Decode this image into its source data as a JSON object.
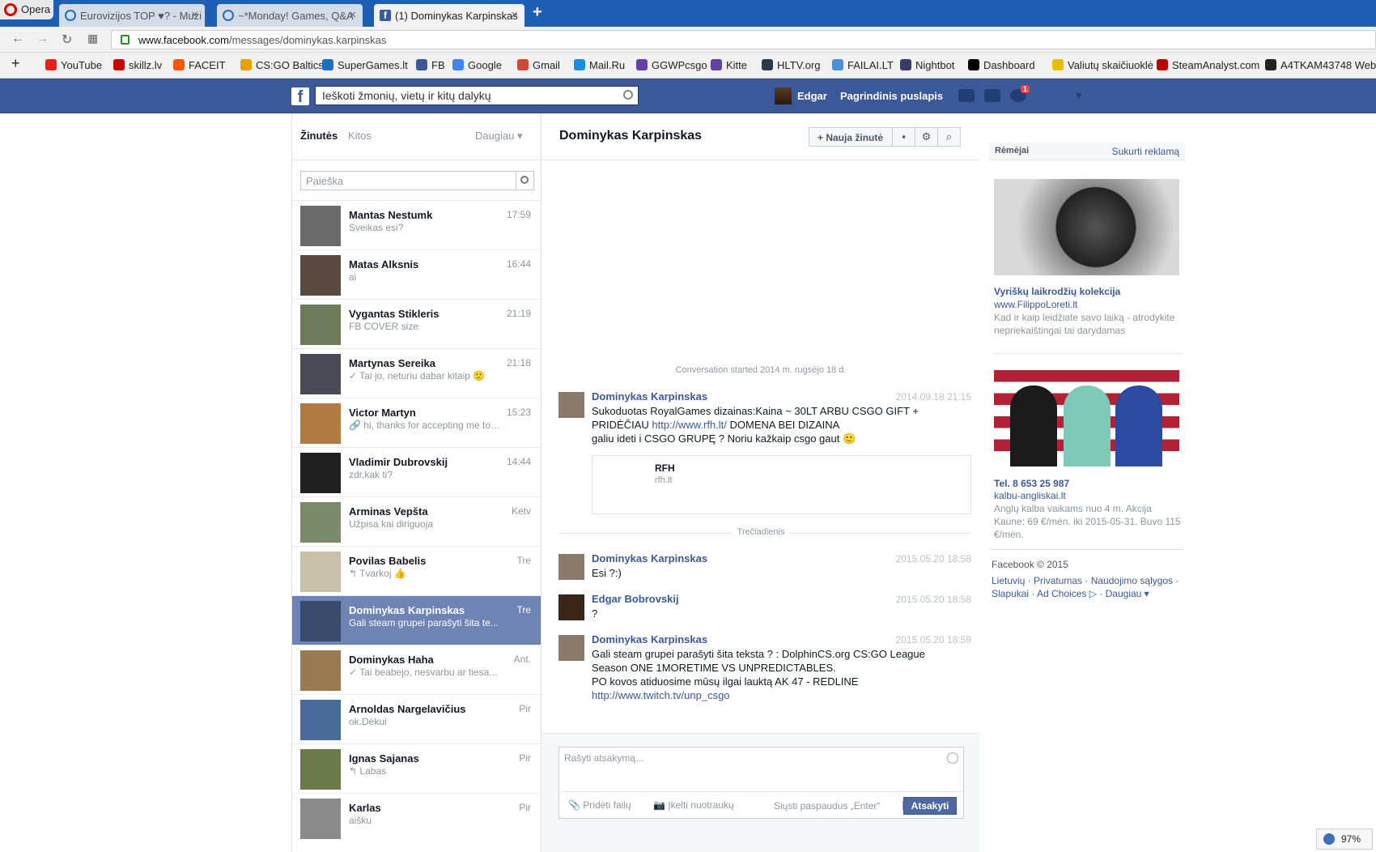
{
  "browser": {
    "opera_label": "Opera",
    "tabs": [
      {
        "label": "Eurovizijos TOP ♥? - Muzi"
      },
      {
        "label": "~*Monday! Games, Q&A"
      },
      {
        "label": "(1) Dominykas Karpinskas"
      }
    ],
    "url_domain": "www.facebook.com",
    "url_path": "/messages/dominykas.karpinskas",
    "bookmarks": [
      {
        "label": "YouTube",
        "color": "#e62117"
      },
      {
        "label": "skillz.lv",
        "color": "#d00000"
      },
      {
        "label": "FACEIT",
        "color": "#ff5500"
      },
      {
        "label": "CS:GO Baltics",
        "color": "#e8a000"
      },
      {
        "label": "SuperGames.lt",
        "color": "#1c6fc4"
      },
      {
        "label": "FB",
        "color": "#3b5998"
      },
      {
        "label": "Google",
        "color": "#4285f4"
      },
      {
        "label": "Gmail",
        "color": "#d44638"
      },
      {
        "label": "Mail.Ru",
        "color": "#168de2"
      },
      {
        "label": "GGWPcsgo",
        "color": "#6441a5"
      },
      {
        "label": "Kitte",
        "color": "#6441a5"
      },
      {
        "label": "HLTV.org",
        "color": "#2b3a4a"
      },
      {
        "label": "FAILAI.LT",
        "color": "#4a90d9"
      },
      {
        "label": "Nightbot",
        "color": "#3b3b6b"
      },
      {
        "label": "Dashboard",
        "color": "#000000"
      },
      {
        "label": "Valiutų skaičiuoklė",
        "color": "#e8c000"
      },
      {
        "label": "SteamAnalyst.com",
        "color": "#c00000"
      },
      {
        "label": "A4TKAM43748 Web",
        "color": "#222222"
      }
    ]
  },
  "fb": {
    "search_placeholder": "Ieškoti žmonių, vietų ir kitų dalykų",
    "user_name": "Edgar",
    "home_label": "Pagrindinis puslapis",
    "notif_count": "1"
  },
  "inbox": {
    "tab_messages": "Žinutės",
    "tab_other": "Kitos",
    "more_label": "Daugiau ▾",
    "search_placeholder": "Paieška",
    "threads": [
      {
        "name": "Mantas Nestumk",
        "snippet": "Sveikas esi?",
        "time": "17:59"
      },
      {
        "name": "Matas Alksnis",
        "snippet": "ai",
        "time": "16:44"
      },
      {
        "name": "Vygantas Stikleris",
        "snippet": "FB COVER size",
        "time": "21:19"
      },
      {
        "name": "Martynas Sereika",
        "snippet": "✓ Tai jo, neturiu dabar kitaip 🙁",
        "time": "21:18"
      },
      {
        "name": "Victor Martyn",
        "snippet": "🔗 hi, thanks for accepting me to t...",
        "time": "15:23"
      },
      {
        "name": "Vladimir Dubrovskij",
        "snippet": "zdr,kak ti?",
        "time": "14:44"
      },
      {
        "name": "Arminas Vepšta",
        "snippet": "Užpisa kai diriguoja",
        "time": "Ketv"
      },
      {
        "name": "Povilas Babelis",
        "snippet": "↰ Tvarkoj 👍",
        "time": "Tre"
      },
      {
        "name": "Dominykas Karpinskas",
        "snippet": "Gali steam grupei parašyti šita te...",
        "time": "Tre"
      },
      {
        "name": "Dominykas Haha",
        "snippet": "✓ Tai beabejo, nesvarbu ar tiesa...",
        "time": "Ant."
      },
      {
        "name": "Arnoldas Nargelavičius",
        "snippet": "ok.Dėkui",
        "time": "Pir"
      },
      {
        "name": "Ignas Sajanas",
        "snippet": "↰ Labas",
        "time": "Pir"
      },
      {
        "name": "Karlas",
        "snippet": "aišku",
        "time": "Pir"
      }
    ]
  },
  "conversation": {
    "title": "Dominykas Karpinskas",
    "new_message_label": "Nauja žinutė",
    "started_text": "Conversation started 2014 m. rugsėjo 18 d.",
    "msg1": {
      "name": "Dominykas Karpinskas",
      "time": "2014.09.18 21:15",
      "line1": "Sukoduotas RoyalGames dizainas:Kaina ~ 30LT ARBU CSGO GIFT  +",
      "line2a": "PRIDĖČIAU ",
      "link": "http://www.rfh.lt/",
      "line2b": " DOMENA BEI DIZAINA",
      "line3": " galiu ideti i CSGO GRUPĘ ? Noriu kažkaip csgo gaut 🙂"
    },
    "link_card": {
      "title": "RFH",
      "domain": "rfh.lt"
    },
    "day_divider": "Trečiadienis",
    "msg2": {
      "name": "Dominykas Karpinskas",
      "time": "2015.05.20 18:58",
      "text": "Esi ?:)"
    },
    "msg3": {
      "name": "Edgar Bobrovskij",
      "time": "2015.05.20 18:58",
      "text": "?"
    },
    "msg4": {
      "name": "Dominykas Karpinskas",
      "time": "2015.05.20 18:59",
      "line1": "Gali steam grupei parašyti šita teksta ? : DolphinCS.org CS:GO League",
      "line2": "Season ONE 1MORETIME VS UNPREDICTABLES.",
      "line3": "PO kovos atiduosime mūsų ilgai lauktą AK 47 - REDLINE",
      "link": "http://www.twitch.tv/unp_csgo"
    },
    "composer": {
      "placeholder": "Rašyti atsakymą...",
      "attach_label": "Pridėti failų",
      "photo_label": "Įkelti nuotraukų",
      "enter_label": "Siųsti paspaudus „Enter“",
      "reply_label": "Atsakyti"
    }
  },
  "ads": {
    "header": "Rėmėjai",
    "create_label": "Sukurti reklamą",
    "ad1": {
      "title": "Vyriškų laikrodžių kolekcija",
      "domain": "www.FilippoLoreti.lt",
      "text": "Kad ir kaip leidžiate savo laiką - atrodykite nepriekaištingai tai darydamas"
    },
    "ad2": {
      "title": "Tel. 8 653 25 987",
      "domain": "kalbu-angliskai.lt",
      "text": "Anglų kalba vaikams nuo 4 m. Akcija Kaune: 69 €/mėn. iki 2015-05-31. Buvo 115 €/mėn."
    },
    "copyright": "Facebook © 2015",
    "footer_links": "Lietuvių · Privatumas · Naudojimo sąlygos · Slapukai · Ad Choices ▷ · Daugiau ▾"
  },
  "zoom_level": "97%"
}
